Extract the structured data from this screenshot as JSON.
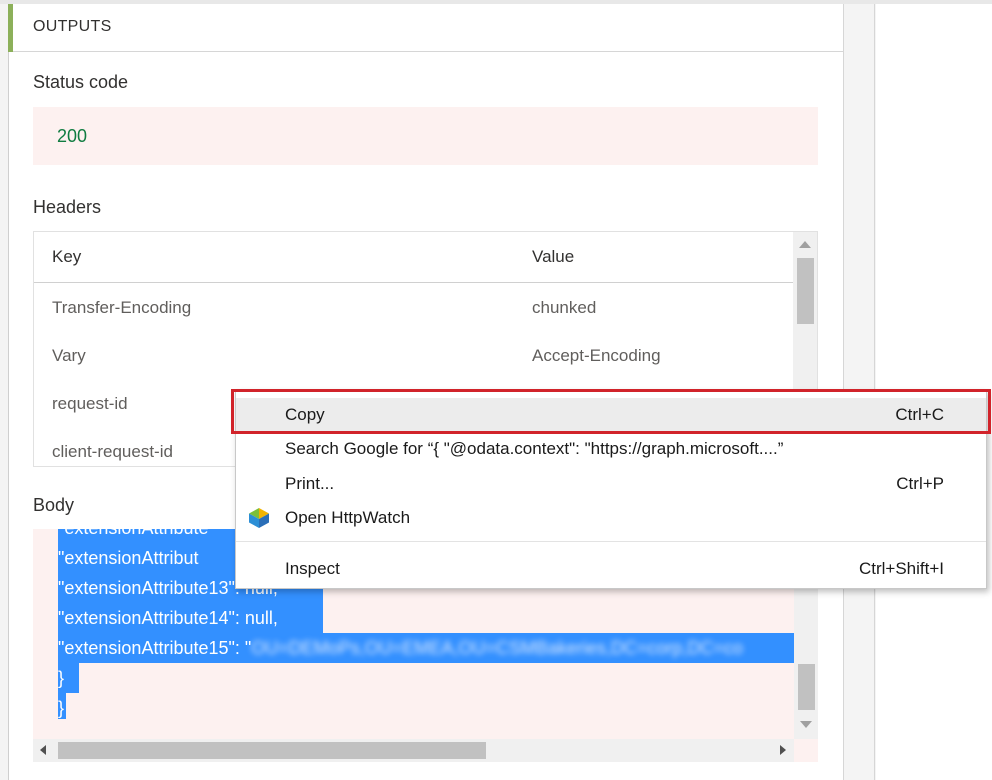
{
  "outputs": {
    "section_title": "OUTPUTS",
    "status_label": "Status code",
    "status_value": "200",
    "headers_label": "Headers",
    "headers": {
      "columns": [
        "Key",
        "Value"
      ],
      "rows": [
        {
          "key": "Transfer-Encoding",
          "value": "chunked"
        },
        {
          "key": "Vary",
          "value": "Accept-Encoding"
        },
        {
          "key": "request-id",
          "value": ""
        },
        {
          "key": "client-request-id",
          "value": ""
        }
      ]
    },
    "body_label": "Body",
    "body_lines": [
      "  \"extensionAttribute",
      "  \"extensionAttribut",
      "  \"extensionAttribute13\": null,",
      "  \"extensionAttribute14\": null,",
      "  \"extensionAttribute15\": \"OU=DEMoPs,OU=EMEA,OU=CSMBakeries,DC=corp,DC=co",
      " }",
      "}"
    ]
  },
  "context_menu": {
    "items": [
      {
        "label": "Copy",
        "shortcut": "Ctrl+C"
      },
      {
        "label": "Search Google for “{   \"@odata.context\": \"https://graph.microsoft....”",
        "shortcut": ""
      },
      {
        "label": "Print...",
        "shortcut": "Ctrl+P"
      },
      {
        "label": "Open HttpWatch",
        "shortcut": "",
        "icon": "httpwatch-icon"
      },
      {
        "label": "Inspect",
        "shortcut": "Ctrl+Shift+I"
      }
    ]
  },
  "colors": {
    "accent": "#8cb05a",
    "status_green": "#107c41",
    "selection": "#3390ff",
    "highlight_red": "#d1232a"
  }
}
